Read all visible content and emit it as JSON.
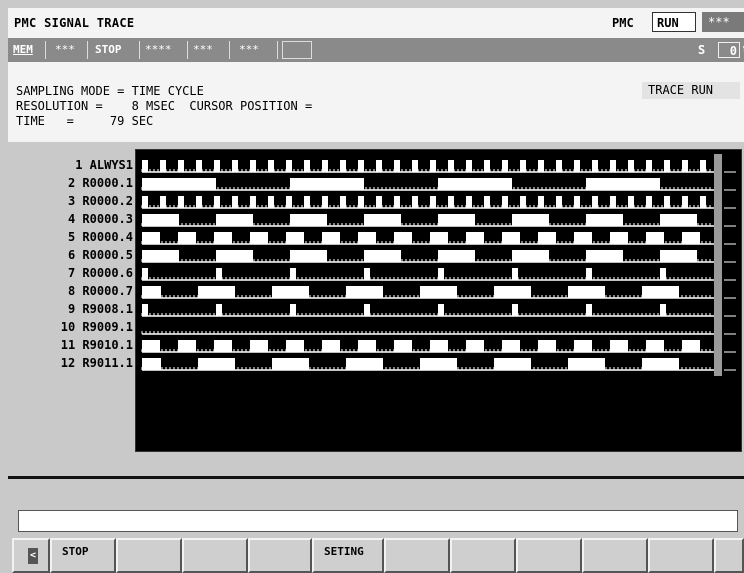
{
  "titlebar": {
    "title": "PMC SIGNAL TRACE",
    "pmc_label": "PMC",
    "pmc_status": "RUN",
    "pmc_extra": "***"
  },
  "statusbar": {
    "items": [
      "MEM",
      "***",
      "STOP",
      "****",
      "***",
      "***"
    ],
    "s_label": "S",
    "s_value": "0",
    "percent": "%"
  },
  "info": {
    "line1": "SAMPLING MODE = TIME CYCLE",
    "line2": "RESOLUTION =    8 MSEC  CURSOR POSITION =",
    "line3": "TIME   =     79 SEC",
    "trace_status": "TRACE RUN"
  },
  "signals": [
    {
      "label": " 1 ALWYS1",
      "pattern": "pulse"
    },
    {
      "label": " 2 R0000.1",
      "pattern": "long-blocks"
    },
    {
      "label": " 3 R0000.2",
      "pattern": "pulse"
    },
    {
      "label": " 4 R0000.3",
      "pattern": "blocks"
    },
    {
      "label": " 5 R0000.4",
      "pattern": "square"
    },
    {
      "label": " 6 R0000.5",
      "pattern": "blocks"
    },
    {
      "label": " 7 R0000.6",
      "pattern": "sparse"
    },
    {
      "label": " 8 R0000.7",
      "pattern": "medium"
    },
    {
      "label": " 9 R9008.1",
      "pattern": "sparse"
    },
    {
      "label": "10 R9009.1",
      "pattern": "flat"
    },
    {
      "label": "11 R9010.1",
      "pattern": "square"
    },
    {
      "label": "12 R9011.1",
      "pattern": "medium"
    }
  ],
  "softkeys": {
    "arrow": "<",
    "keys": [
      "STOP",
      "",
      "",
      "",
      "SETING",
      "",
      "",
      "",
      "",
      "",
      ""
    ]
  },
  "colors": {
    "background": "#c9c9c9",
    "trace_bg": "#000000",
    "trace_fg": "#ffffff",
    "status_bar": "#8a8a8a"
  }
}
